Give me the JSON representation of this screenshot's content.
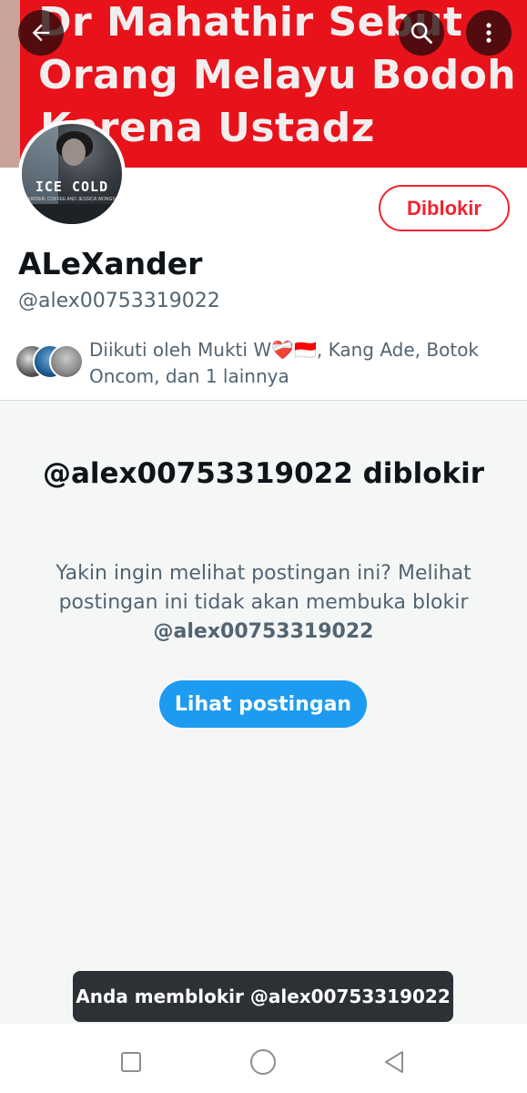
{
  "banner": {
    "lines": [
      "Dr Mahathir Sebut",
      "Orang Melayu Bodoh",
      "Karena Ustadz"
    ]
  },
  "header": {
    "back_icon": "arrow-left-icon",
    "search_icon": "search-icon",
    "more_icon": "more-vertical-icon"
  },
  "avatar": {
    "title": "ICE COLD",
    "subtitle": "MURDER, COFFEE AND JESSICA WONGSO"
  },
  "profile": {
    "blocked_label": "Diblokir",
    "display_name": "ALeXander",
    "handle": "@alex00753319022",
    "followed_by": "Diikuti oleh Mukti W❤️‍🩹🇮🇩, Kang Ade, Botok Oncom, dan 1 lainnya"
  },
  "blocked": {
    "title": "@alex00753319022 diblokir",
    "description_prefix": "Yakin ingin melihat postingan ini? Melihat postingan ini tidak akan membuka blokir",
    "description_handle": "@alex00753319022",
    "view_button": "Lihat postingan"
  },
  "toast": {
    "message": "Anda memblokir @alex00753319022"
  },
  "colors": {
    "accent": "#1d9bf0",
    "danger": "#f4212e",
    "banner_red": "#e8121b"
  }
}
